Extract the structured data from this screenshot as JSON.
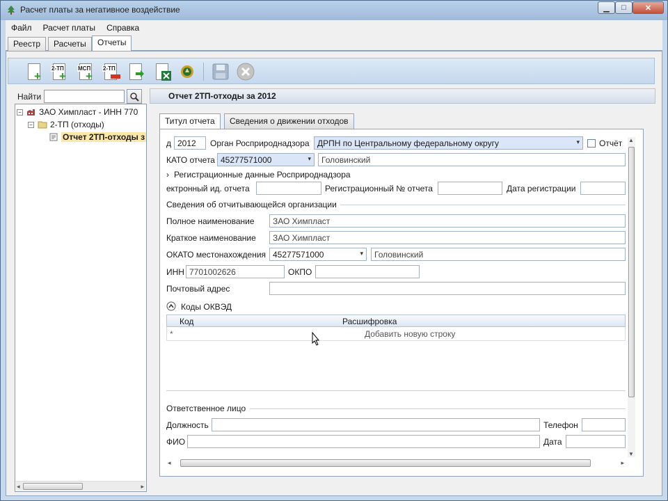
{
  "window": {
    "title": "Расчет платы за негативное воздействие",
    "min_icon": "minimize-icon",
    "max_icon": "maximize-icon",
    "close_icon": "close-icon"
  },
  "menu": [
    "Файл",
    "Расчет платы",
    "Справка"
  ],
  "main_tabs": [
    "Реестр",
    "Расчеты",
    "Отчеты"
  ],
  "toolbar": {
    "buttons": [
      {
        "icon": "new-document-icon",
        "label": ""
      },
      {
        "icon": "new-2tp-icon",
        "label": "2-ТП"
      },
      {
        "icon": "new-msp-icon",
        "label": "МСП"
      },
      {
        "icon": "delete-2tp-icon",
        "label": "2-ТП"
      },
      {
        "icon": "export-icon",
        "label": ""
      },
      {
        "icon": "excel-export-icon",
        "label": ""
      },
      {
        "icon": "emblem-icon",
        "label": ""
      },
      {
        "icon": "save-icon",
        "label": ""
      },
      {
        "icon": "cancel-icon",
        "label": ""
      }
    ]
  },
  "left": {
    "find_label": "Найти",
    "tree": [
      {
        "label": "ЗАО Химпласт - ИНН 770",
        "level": 0
      },
      {
        "label": "2-ТП (отходы)",
        "level": 1
      },
      {
        "label": "Отчет 2ТП-отходы з",
        "level": 2
      }
    ]
  },
  "right": {
    "header": "Отчет 2ТП-отходы за 2012",
    "subtabs": [
      "Титул отчета",
      "Сведения о движении отходов"
    ],
    "form": {
      "year_label": "д",
      "year_value": "2012",
      "organ_label": "Орган Росприроднадзора",
      "organ_value": "ДРПН по Центральному федеральному округу",
      "report_checkbox_label": "Отчёт",
      "okato_label": "КАТО отчета",
      "okato_value": "45277571000",
      "okato_name": "Головинский",
      "reg_section": "Регистрационные данные Росприроднадзора",
      "electronic_id_label": "ектронный ид. отчета",
      "reg_no_label": "Регистрационный № отчета",
      "reg_date_label": "Дата регистрации",
      "org_section": "Сведения об отчитывающейся организации",
      "full_name_label": "Полное наименование",
      "full_name_value": "ЗАО Химпласт",
      "short_name_label": "Краткое наименование",
      "short_name_value": "ЗАО Химпласт",
      "okato_loc_label": "ОКАТО местонахождения",
      "okato_loc_value": "45277571000",
      "okato_loc_name": "Головинский",
      "inn_label": "ИНН",
      "inn_value": "7701002626",
      "okpo_label": "ОКПО",
      "postal_label": "Почтовый адрес",
      "okved_section": "Коды ОКВЭД",
      "grid_col_code": "Код",
      "grid_col_decode": "Расшифровка",
      "grid_new_row": "Добавить новую строку",
      "grid_new_marker": "*",
      "resp_section": "Ответственное лицо",
      "position_label": "Должность",
      "phone_label": "Телефон",
      "fio_label": "ФИО",
      "date_label": "Дата"
    }
  }
}
